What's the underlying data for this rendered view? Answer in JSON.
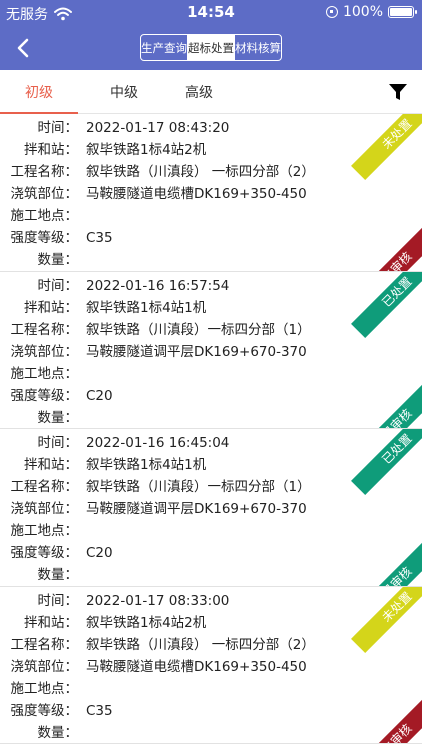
{
  "status_bar": {
    "carrier": "无服务",
    "time": "14:54",
    "battery": "100%",
    "battery_level": 1.0
  },
  "segments": [
    {
      "label": "生产查询",
      "active": false
    },
    {
      "label": "超标处置",
      "active": true
    },
    {
      "label": "材料核算",
      "active": false
    }
  ],
  "tabs": [
    {
      "label": "初级",
      "active": true
    },
    {
      "label": "中级",
      "active": false
    },
    {
      "label": "高级",
      "active": false
    }
  ],
  "labels": {
    "time": "时间：",
    "station": "拌和站：",
    "project": "工程名称：",
    "part": "浇筑部位：",
    "site": "施工地点：",
    "grade": "强度等级：",
    "qty": "数量："
  },
  "records": [
    {
      "time": "2022-01-17 08:43:20",
      "station": "叙毕铁路1标4站2机",
      "project": "叙毕铁路（川滇段） 一标四分部（2）",
      "part": "马鞍腰隧道电缆槽DK169+350-450",
      "site": "",
      "grade": "C35",
      "qty": "",
      "status_top": "未处置",
      "status_bottom": "未审核"
    },
    {
      "time": "2022-01-16 16:57:54",
      "station": "叙毕铁路1标4站1机",
      "project": "叙毕铁路（川滇段）一标四分部（1）",
      "part": "马鞍腰隧道调平层DK169+670-370",
      "site": "",
      "grade": "C20",
      "qty": "",
      "status_top": "已处置",
      "status_bottom": "已审核"
    },
    {
      "time": "2022-01-16 16:45:04",
      "station": "叙毕铁路1标4站1机",
      "project": "叙毕铁路（川滇段）一标四分部（1）",
      "part": "马鞍腰隧道调平层DK169+670-370",
      "site": "",
      "grade": "C20",
      "qty": "",
      "status_top": "已处置",
      "status_bottom": "已审核"
    },
    {
      "time": "2022-01-17 08:33:00",
      "station": "叙毕铁路1标4站2机",
      "project": "叙毕铁路（川滇段） 一标四分部（2）",
      "part": "马鞍腰隧道电缆槽DK169+350-450",
      "site": "",
      "grade": "C35",
      "qty": "",
      "status_top": "未处置",
      "status_bottom": "未审核"
    }
  ],
  "colors": {
    "header": "#5d6cc6",
    "accent": "#e8604c",
    "pending_dispose": "#d4d51a",
    "done": "#0f9c7a",
    "pending_review": "#a41a25"
  }
}
